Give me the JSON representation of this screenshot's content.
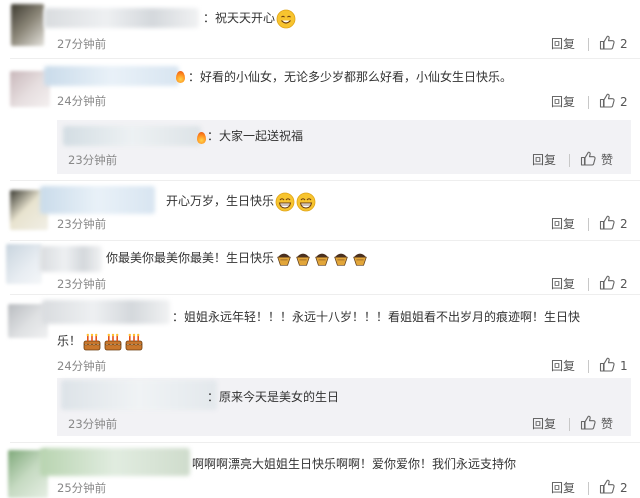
{
  "comments": [
    {
      "text": "：祝天天开心",
      "time": "27分钟前",
      "reply": "回复",
      "likes": "2"
    },
    {
      "text": "：好看的小仙女，无论多少岁都那么好看，小仙女生日快乐。",
      "time": "24分钟前",
      "reply": "回复",
      "likes": "2",
      "sub": {
        "text": "：大家一起送祝福",
        "time": "23分钟前",
        "reply": "回复",
        "likes": "赞"
      }
    },
    {
      "text": "开心万岁，生日快乐",
      "time": "23分钟前",
      "reply": "回复",
      "likes": "2"
    },
    {
      "text": "你最美你最美你最美！生日快乐",
      "time": "23分钟前",
      "reply": "回复",
      "likes": "2"
    },
    {
      "text_line1": "：姐姐永远年轻！！！永远十八岁！！！看姐姐看不出岁月的痕迹啊！生日快",
      "text_line2": "乐！",
      "time": "24分钟前",
      "reply": "回复",
      "likes": "1",
      "sub": {
        "text": "：原来今天是美女的生日",
        "time": "23分钟前",
        "reply": "回复",
        "likes": "赞"
      }
    },
    {
      "text": "啊啊啊漂亮大姐姐生日快乐啊啊！爱你爱你！我们永远支持你",
      "time": "25分钟前",
      "reply": "回复",
      "likes": "2"
    }
  ],
  "icons": {
    "like": "thumbs-up-icon",
    "emoji_smile": "smile-emoji-icon",
    "emoji_grin": "grin-emoji-icon",
    "cake": "cake-emoji-icon",
    "shaved_ice": "dessert-emoji-icon"
  },
  "colors": {
    "text": "#333333",
    "meta": "#888888",
    "subbox_bg": "#f2f2f5",
    "emoji_yellow": "#f7c42f"
  }
}
